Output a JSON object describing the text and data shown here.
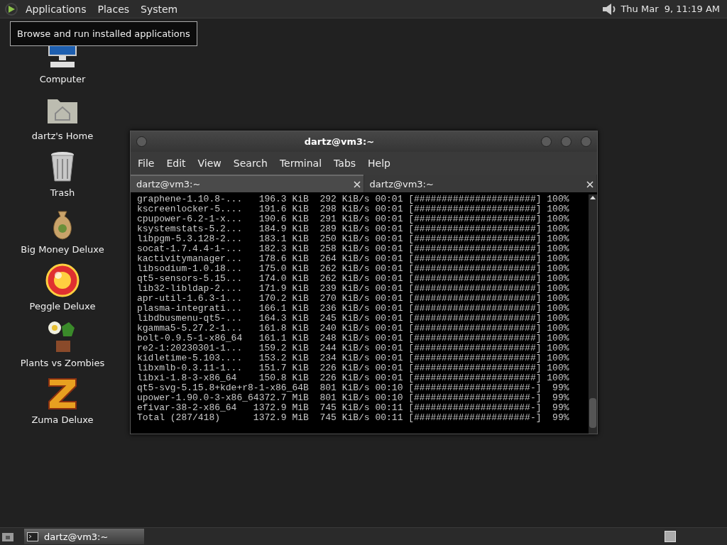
{
  "top_panel": {
    "menus": [
      "Applications",
      "Places",
      "System"
    ],
    "clock": "Thu Mar  9, 11:19 AM"
  },
  "tooltip": "Browse and run installed applications",
  "desktop_icons": [
    {
      "label": "Computer",
      "kind": "computer"
    },
    {
      "label": "dartz's Home",
      "kind": "home"
    },
    {
      "label": "Trash",
      "kind": "trash"
    },
    {
      "label": "Big Money Deluxe",
      "kind": "money"
    },
    {
      "label": "Peggle Deluxe",
      "kind": "peggle"
    },
    {
      "label": "Plants vs Zombies",
      "kind": "plants"
    },
    {
      "label": "Zuma Deluxe",
      "kind": "zuma"
    }
  ],
  "terminal": {
    "title": "dartz@vm3:~",
    "menu": [
      "File",
      "Edit",
      "View",
      "Search",
      "Terminal",
      "Tabs",
      "Help"
    ],
    "tabs": [
      {
        "label": "dartz@vm3:~",
        "selected": true
      },
      {
        "label": "dartz@vm3:~",
        "selected": false
      }
    ],
    "lines": [
      "graphene-1.10.8-...   196.3 KiB  292 KiB/s 00:01 [######################] 100%",
      "kscreenlocker-5....   191.6 KiB  298 KiB/s 00:01 [######################] 100%",
      "cpupower-6.2-1-x...   190.6 KiB  291 KiB/s 00:01 [######################] 100%",
      "ksystemstats-5.2...   184.9 KiB  289 KiB/s 00:01 [######################] 100%",
      "libpgm-5.3.128-2...   183.1 KiB  250 KiB/s 00:01 [######################] 100%",
      "socat-1.7.4.4-1-...   182.3 KiB  258 KiB/s 00:01 [######################] 100%",
      "kactivitymanager...   178.6 KiB  264 KiB/s 00:01 [######################] 100%",
      "libsodium-1.0.18...   175.0 KiB  262 KiB/s 00:01 [######################] 100%",
      "qt5-sensors-5.15...   174.0 KiB  262 KiB/s 00:01 [######################] 100%",
      "lib32-libldap-2....   171.9 KiB  239 KiB/s 00:01 [######################] 100%",
      "apr-util-1.6.3-1...   170.2 KiB  270 KiB/s 00:01 [######################] 100%",
      "plasma-integrati...   166.1 KiB  236 KiB/s 00:01 [######################] 100%",
      "libdbusmenu-qt5-...   164.3 KiB  245 KiB/s 00:01 [######################] 100%",
      "kgamma5-5.27.2-1...   161.8 KiB  240 KiB/s 00:01 [######################] 100%",
      "bolt-0.9.5-1-x86_64   161.1 KiB  248 KiB/s 00:01 [######################] 100%",
      "re2-1:20230301-1...   159.2 KiB  244 KiB/s 00:01 [######################] 100%",
      "kidletime-5.103....   153.2 KiB  234 KiB/s 00:01 [######################] 100%",
      "libxmlb-0.3.11-1...   151.7 KiB  226 KiB/s 00:01 [######################] 100%",
      "libxi-1.8-3-x86_64    150.8 KiB  226 KiB/s 00:01 [######################] 100%",
      "qt5-svg-5.15.8+kde+r8-1-x86_64B  801 KiB/s 00:10 [#####################-]  99%",
      "upower-1.90.0-3-x86_64372.7 MiB  801 KiB/s 00:10 [#####################-]  99%",
      "efivar-38-2-x86_64   1372.9 MiB  745 KiB/s 00:11 [#####################-]  99%",
      "Total (287/418)      1372.9 MiB  745 KiB/s 00:11 [#####################-]  99%"
    ]
  },
  "taskbar": {
    "tasks": [
      {
        "label": "dartz@vm3:~",
        "selected": true
      }
    ]
  }
}
